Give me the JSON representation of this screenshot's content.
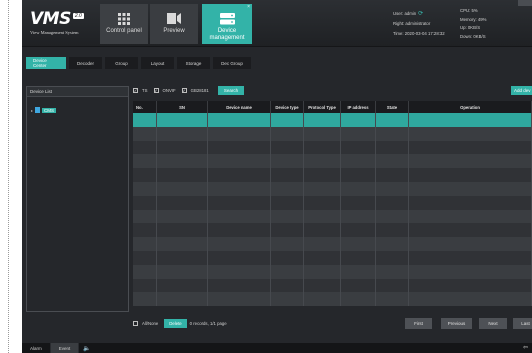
{
  "logo": {
    "brand": "VMS",
    "version": "2.0",
    "subtitle": "View Management System"
  },
  "modules": [
    {
      "label": "Control panel",
      "icon": "grid-icon"
    },
    {
      "label": "Preview",
      "icon": "video-camera-icon"
    },
    {
      "label": "Device management",
      "icon": "server-icon",
      "close": "×"
    }
  ],
  "sysinfo": {
    "user": "User: admin",
    "right": "Right: administrator",
    "time": "Time: 2020-03-04 17:28:32",
    "cpu": "CPU: 5%",
    "memory": "Memory: 49%",
    "up": "Up: 0KB/S",
    "down": "Down: 0KB/S"
  },
  "tabs": [
    "Device Center",
    "Decoder",
    "Group",
    "Layout",
    "Storage",
    "Dec Group"
  ],
  "device_list": {
    "title": "Device List",
    "root": "CMS"
  },
  "filters": {
    "options": [
      "TS",
      "ONVIF",
      "GB28181"
    ],
    "search": "Search",
    "add": "Add dev"
  },
  "table": {
    "columns": [
      "No.",
      "SN",
      "Device name",
      "Device type",
      "Protocol Type",
      "IP address",
      "State",
      "Operation"
    ],
    "rows": 14
  },
  "footer": {
    "all": "All/None",
    "delete": "Delete",
    "records": "0 records,  1/1 page"
  },
  "pager": [
    "First",
    "Previous",
    "Next",
    "Last"
  ],
  "bottom": {
    "tabs": [
      "Alarm",
      "Event"
    ]
  },
  "colors": {
    "accent": "#33b3a8",
    "background": "#25272b"
  }
}
